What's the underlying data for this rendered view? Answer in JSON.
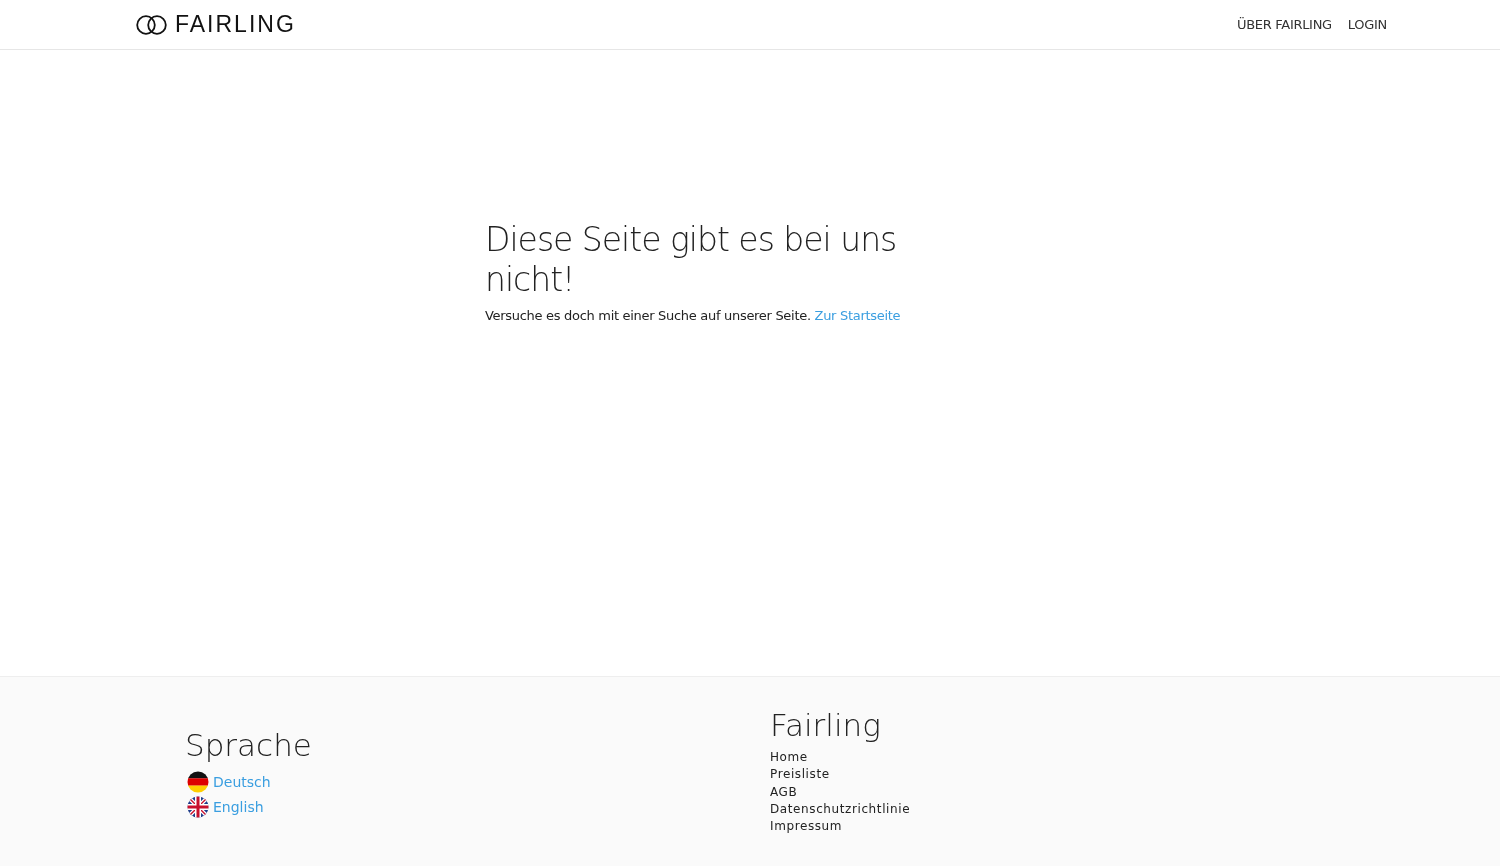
{
  "header": {
    "logo": "FAIRLING",
    "nav": [
      {
        "label": "ÜBER FAIRLING"
      },
      {
        "label": "LOGIN"
      }
    ]
  },
  "main": {
    "heading": "Diese Seite gibt es bei uns nicht!",
    "text": "Versuche es doch mit einer Suche auf unserer Seite.",
    "link": "Zur Startseite"
  },
  "footer": {
    "language": {
      "title": "Sprache",
      "items": [
        {
          "label": "Deutsch",
          "kind": "de"
        },
        {
          "label": "English",
          "kind": "gb"
        }
      ]
    },
    "links": {
      "title": "Fairling",
      "items": [
        "Home",
        "Preisliste",
        "AGB",
        "Datenschutzrichtlinie",
        "Impressum"
      ]
    }
  }
}
